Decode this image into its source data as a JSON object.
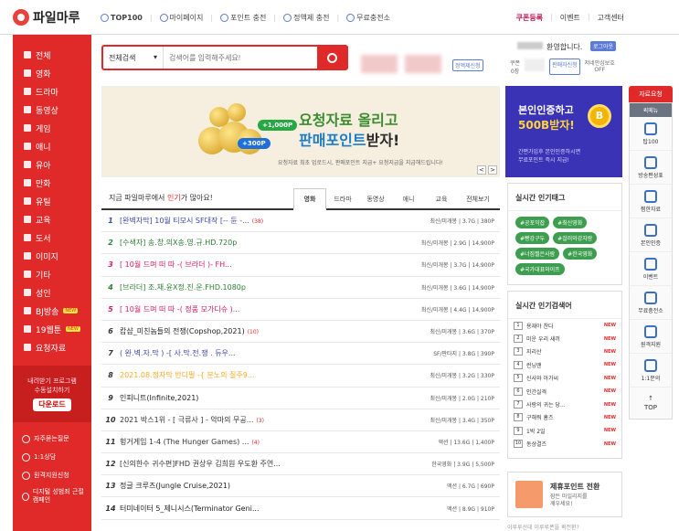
{
  "header": {
    "logo": "파일마루",
    "nav": [
      "TOP100",
      "마이페이지",
      "포인트 충전",
      "정액제 충전",
      "무료충전소"
    ],
    "right": [
      "쿠폰등록",
      "이벤트",
      "고객센터"
    ]
  },
  "sidebar": {
    "items": [
      "전체",
      "영화",
      "드라마",
      "동영상",
      "게임",
      "애니",
      "유아",
      "만화",
      "유틸",
      "교육",
      "도서",
      "이미지",
      "기타",
      "성인",
      "BJ방송",
      "19웹툰",
      "요청자료"
    ],
    "new_badge": "NEW",
    "promo": [
      "내려받기 프로그램",
      "수동설치하기"
    ],
    "download": "다운로드",
    "bottom": [
      "자주묻는질문",
      "1:1상담",
      "원격지원신청",
      "디지털 성범죄 근절 캠페인"
    ]
  },
  "search": {
    "select": "전체검색",
    "placeholder": "검색어를 입력해주세요!"
  },
  "user": {
    "greeting": "환영합니다.",
    "logout": "로그아웃",
    "regular": "정액제신청",
    "coupon_label": "쿠폰",
    "coupon_val": "0장",
    "seller": "판매자신청",
    "protect": "저네안심보호",
    "protect_state": "OFF"
  },
  "banner": {
    "line1": "요청자료 올리고",
    "line2a": "판매포인트",
    "line2b": "받자!",
    "sub": "요청자료 최초 업로드시, 판매포인트 지급+ 요청지급을 지급해드립니다!",
    "badge1": "+1,000P",
    "badge2": "+300P",
    "prev": "<",
    "next": ">"
  },
  "ad": {
    "l1": "본인인증하고",
    "l2": "500B받자!",
    "l3": "간편가입후 본인인증하시면",
    "l4": "무료포인트 즉시 지급!",
    "coin": "B"
  },
  "rside": {
    "req": "자료요청",
    "title": "퀵메뉴",
    "items": [
      "탑100",
      "방송편성표",
      "찜한자료",
      "본인인증",
      "이벤트",
      "무료충전소",
      "원격지원",
      "1:1문의"
    ],
    "top": "TOP"
  },
  "list": {
    "heading_a": "지금 파일마루에서 ",
    "heading_b": "인기",
    "heading_c": "가 많아요!",
    "tabs": [
      "영화",
      "드라마",
      "동영상",
      "애니",
      "교육",
      "전체보기"
    ],
    "rows": [
      {
        "no": "1",
        "title": "[완벽자막] 10월 티모시 SF대작 [-- 듄 -...",
        "cnt": "(38)",
        "meta": "최신/미개봉 | 3.7G | 380P",
        "color": "#3949ab"
      },
      {
        "no": "2",
        "title": "[수색자] 송.창.의X송.영.규.HD.720p",
        "cnt": "",
        "meta": "최신/미개봉 | 2.9G | 14,900P",
        "color": "#2e7d32"
      },
      {
        "no": "3",
        "title": "[ 10월 드며 떠 따 -( 브라더 )- FH...",
        "cnt": "",
        "meta": "최신/미개봉 | 3.7G | 14,900P",
        "color": "#d81b60"
      },
      {
        "no": "4",
        "title": "[브라더] 조.채.윤X정.진.운.FHD.1080p",
        "cnt": "",
        "meta": "최신/미개봉 | 3.6G | 14,900P",
        "color": "#2e7d32"
      },
      {
        "no": "5",
        "title": "[ 10월 드며 떠 따 -( 정품 모가디슈 )...",
        "cnt": "",
        "meta": "최신/미개봉 | 4.4G | 14,900P",
        "color": "#d81b60"
      },
      {
        "no": "6",
        "title": "캅샵_미친놈들의 전쟁(Copshop,2021)",
        "cnt": "(10)",
        "meta": "최신/미개봉 | 3.6G | 370P",
        "color": "#222"
      },
      {
        "no": "7",
        "title": "( 완.벽.자.막 ) -[ 사.막.전.쟁 . 듀우...",
        "cnt": "",
        "meta": "SF/판타지 | 3.8G | 390P",
        "color": "#3949ab"
      },
      {
        "no": "8",
        "title": "2021.08.정자막 반디펄 -{ 분노의 질주9...",
        "cnt": "",
        "meta": "최신/미개봉 | 3.2G | 330P",
        "color": "#f9a825"
      },
      {
        "no": "9",
        "title": "인피니트(Infinite,2021)",
        "cnt": "",
        "meta": "최신/미개봉 | 2.0G | 210P",
        "color": "#222"
      },
      {
        "no": "10",
        "title": "2021 박스1위 - [ 극류사 ] - 악마의 무공...",
        "cnt": "(3)",
        "meta": "최신/미개봉 | 3.4G | 350P",
        "color": "#333"
      },
      {
        "no": "11",
        "title": "헝거게임 1-4 (The Hunger Games) ...",
        "cnt": "(4)",
        "meta": "액션 | 13.6G | 1,400P",
        "color": "#333"
      },
      {
        "no": "12",
        "title": "[신의한수 귀수편]FHD 권상우 김희원 우도환 주연...",
        "cnt": "",
        "meta": "한국영화 | 3.9G | 5,500P",
        "color": "#333"
      },
      {
        "no": "13",
        "title": "정글 크루즈(Jungle Cruise,2021)",
        "cnt": "",
        "meta": "액션 | 6.7G | 690P",
        "color": "#222"
      },
      {
        "no": "14",
        "title": "터미네이터 5_제니시스(Terminator Geni...",
        "cnt": "",
        "meta": "액션 | 8.9G | 910P",
        "color": "#222"
      }
    ]
  },
  "tags": {
    "title": "실시간 인기태그",
    "items": [
      "#공포익잡",
      "#최신영화",
      "#빵강구두",
      "#걸러와강자랑",
      "#너짐찔은사람",
      "#한국영화",
      "#국가대표와이프"
    ]
  },
  "hot": {
    "title": "실시간 인기검색어",
    "new": "NEW",
    "items": [
      "용재야 찬다",
      "미운 우리 새끼",
      "지리산",
      "런닝맨",
      "신사와 아가씨",
      "인간실격",
      "사랑의 귀는 당...",
      "구해줘 홈즈",
      "1박 2일",
      "동상결즈"
    ]
  },
  "conv": {
    "title": "제휴포인트 전환",
    "sub1": "잠든 마일리지를",
    "sub2": "깨우세요!",
    "foot": "이루루선데 이루루폰을 퀵전환?"
  },
  "colors": {
    "accent": "#e02a2a",
    "tag": "#3e9e4f",
    "ad": "#3a33b5"
  }
}
